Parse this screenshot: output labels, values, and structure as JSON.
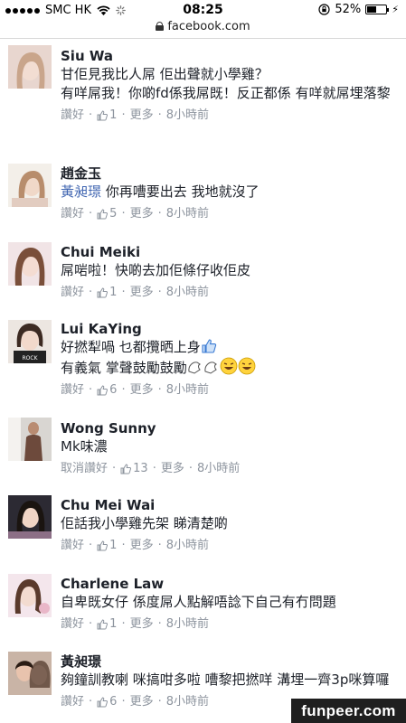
{
  "status_bar": {
    "carrier": "SMC HK",
    "time": "08:25",
    "battery": "52%",
    "battery_level": 0.52
  },
  "url_bar": {
    "domain": "facebook.com"
  },
  "comments": [
    {
      "name": "Siu Wa",
      "mention": "",
      "text": "甘佢見我比人屌 佢出聲就小學雞？\n有咩屌我！你啲fd係我屌既！反正都係 有咩就屌埋落黎",
      "action": "讚好",
      "likes": "1",
      "more": "更多",
      "time": "8小時前"
    },
    {
      "name": "趙金玉",
      "mention": "黃昶璟",
      "text": "你再嘈要出去 我地就沒了",
      "action": "讚好",
      "likes": "5",
      "more": "更多",
      "time": "8小時前"
    },
    {
      "name": "Chui Meiki",
      "mention": "",
      "text": "屌啱啦！快啲去加佢條仔收佢皮",
      "action": "讚好",
      "likes": "1",
      "more": "更多",
      "time": "8小時前"
    },
    {
      "name": "Lui KaYing",
      "mention": "",
      "text_line1": "好撚犁喎 乜都攬晒上身",
      "text_line2": "有義氣 掌聲鼓勵鼓勵",
      "action": "讚好",
      "likes": "6",
      "more": "更多",
      "time": "8小時前"
    },
    {
      "name": "Wong Sunny",
      "mention": "",
      "text": "Mk味濃",
      "action": "取消讚好",
      "likes": "13",
      "more": "更多",
      "time": "8小時前"
    },
    {
      "name": "Chu Mei Wai",
      "mention": "",
      "text": "佢話我小學雞先架 睇清楚啲",
      "action": "讚好",
      "likes": "1",
      "more": "更多",
      "time": "8小時前"
    },
    {
      "name": "Charlene Law",
      "mention": "",
      "text": "自卑既女仔 係度屌人點解唔諗下自己有冇問題",
      "action": "讚好",
      "likes": "1",
      "more": "更多",
      "time": "8小時前"
    },
    {
      "name": "黃昶璟",
      "mention": "",
      "text": "夠鐘訓教喇 咪搞咁多啦 嘈黎把撚咩 溝埋一齊3p咪算囉",
      "action": "讚好",
      "likes": "6",
      "more": "更多",
      "time": "8小時前"
    }
  ],
  "watermark": "funpeer.com"
}
